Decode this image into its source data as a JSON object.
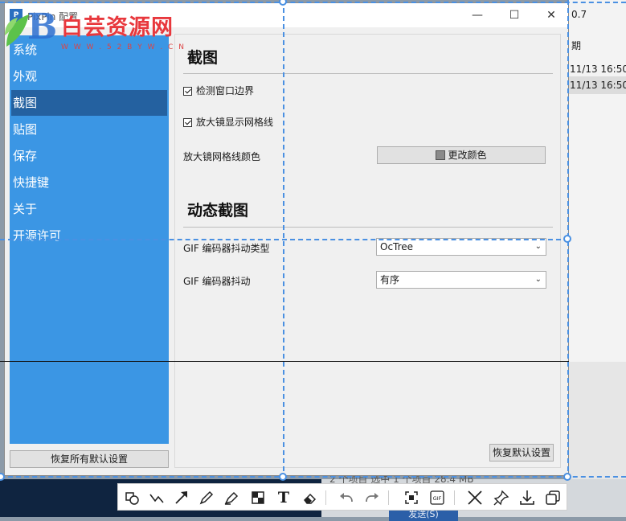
{
  "background": {
    "version_fragment": "0.7",
    "column_header_fragment": "期",
    "row1_time": "11/13 16:50",
    "row2_time": "11/13 16:50",
    "status_text": "2 个项目    选中 1 个项目  28.4 MB",
    "send_button": "发送(S)"
  },
  "watermark": {
    "brand": "白芸资源网",
    "url": "W W W . 5 2 B Y W . C N"
  },
  "window": {
    "title": "PixPin 配置",
    "minimize": "—",
    "maximize": "☐",
    "close": "✕"
  },
  "sidebar": {
    "items": [
      {
        "label": "系统",
        "active": false
      },
      {
        "label": "外观",
        "active": false
      },
      {
        "label": "截图",
        "active": true
      },
      {
        "label": "贴图",
        "active": false
      },
      {
        "label": "保存",
        "active": false
      },
      {
        "label": "快捷键",
        "active": false
      },
      {
        "label": "关于",
        "active": false
      },
      {
        "label": "开源许可",
        "active": false
      }
    ],
    "reset_all": "恢复所有默认设置"
  },
  "screenshot_section": {
    "title": "截图",
    "detect_window_border": {
      "label": "检测窗口边界",
      "checked": true
    },
    "magnifier_grid": {
      "label": "放大镜显示网格线",
      "checked": true
    },
    "grid_color_label": "放大镜网格线颜色",
    "change_color_button": "更改颜色"
  },
  "dynamic_section": {
    "title": "动态截图",
    "dither_type_label": "GIF 编码器抖动类型",
    "dither_type_value": "OcTree",
    "dither_label": "GIF 编码器抖动",
    "dither_value": "有序"
  },
  "reset_defaults": "恢复默认设置",
  "toolbar": {
    "icons": [
      "shape-icon",
      "polyline-icon",
      "arrow-icon",
      "pencil-icon",
      "marker-icon",
      "mosaic-icon",
      "text-icon",
      "eraser-icon",
      "undo-icon",
      "redo-icon",
      "scan-icon",
      "gif-icon",
      "cancel-icon",
      "pin-icon",
      "download-icon",
      "copy-icon"
    ],
    "text_tool": "T",
    "gif_tool": "GIF"
  }
}
